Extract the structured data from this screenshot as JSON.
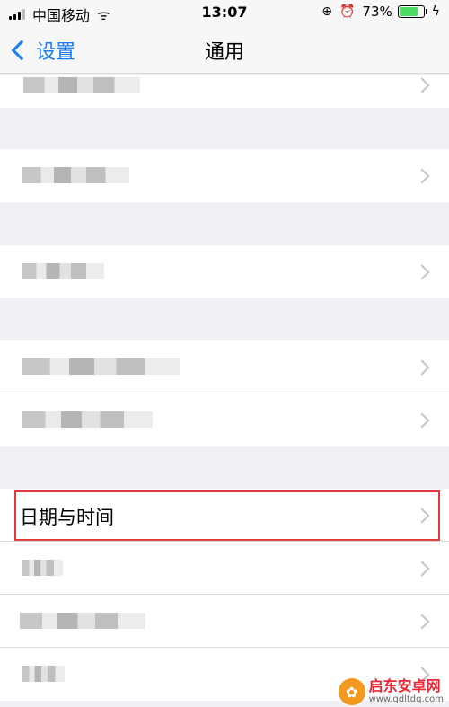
{
  "status": {
    "carrier": "中国移动",
    "time": "13:07",
    "battery_pct": "73%"
  },
  "nav": {
    "back_label": "设置",
    "title": "通用"
  },
  "rows": {
    "date_time": "日期与时间"
  },
  "watermark": {
    "title": "启东安卓网",
    "url": "www.qdltdq.com"
  }
}
